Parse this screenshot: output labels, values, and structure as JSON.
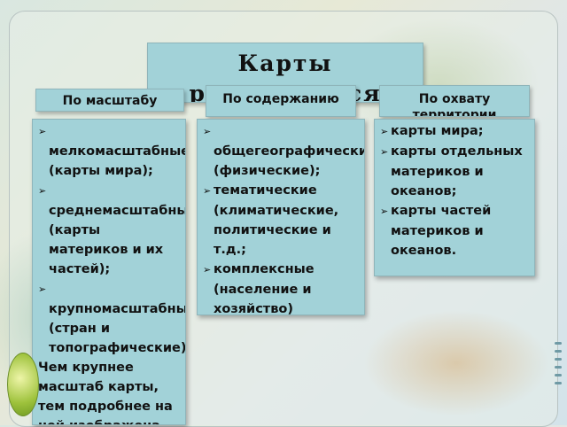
{
  "slide": {
    "title": "Карты различаются",
    "columns": [
      {
        "header": "По масштабу",
        "items": [
          "мелкомасштабные (карты мира);",
          "среднемасштабные (карты материков и их частей);",
          "крупномасштабные (стран и топографические)."
        ],
        "note": "Чем крупнее масштаб карты, тем подробнее на ней изображена"
      },
      {
        "header": "По содержанию",
        "items": [
          "общегеографические (физические);",
          "тематические (климатические, политические и т.д.;",
          "комплексные (население и хозяйство)"
        ]
      },
      {
        "header": "По охвату территории",
        "items": [
          "карты мира;",
          "карты отдельных материков и океанов;",
          "карты частей материков и океанов."
        ]
      }
    ],
    "bullet_icon": "arrow-bullet-icon",
    "accent_color": "#a2d2d8"
  }
}
